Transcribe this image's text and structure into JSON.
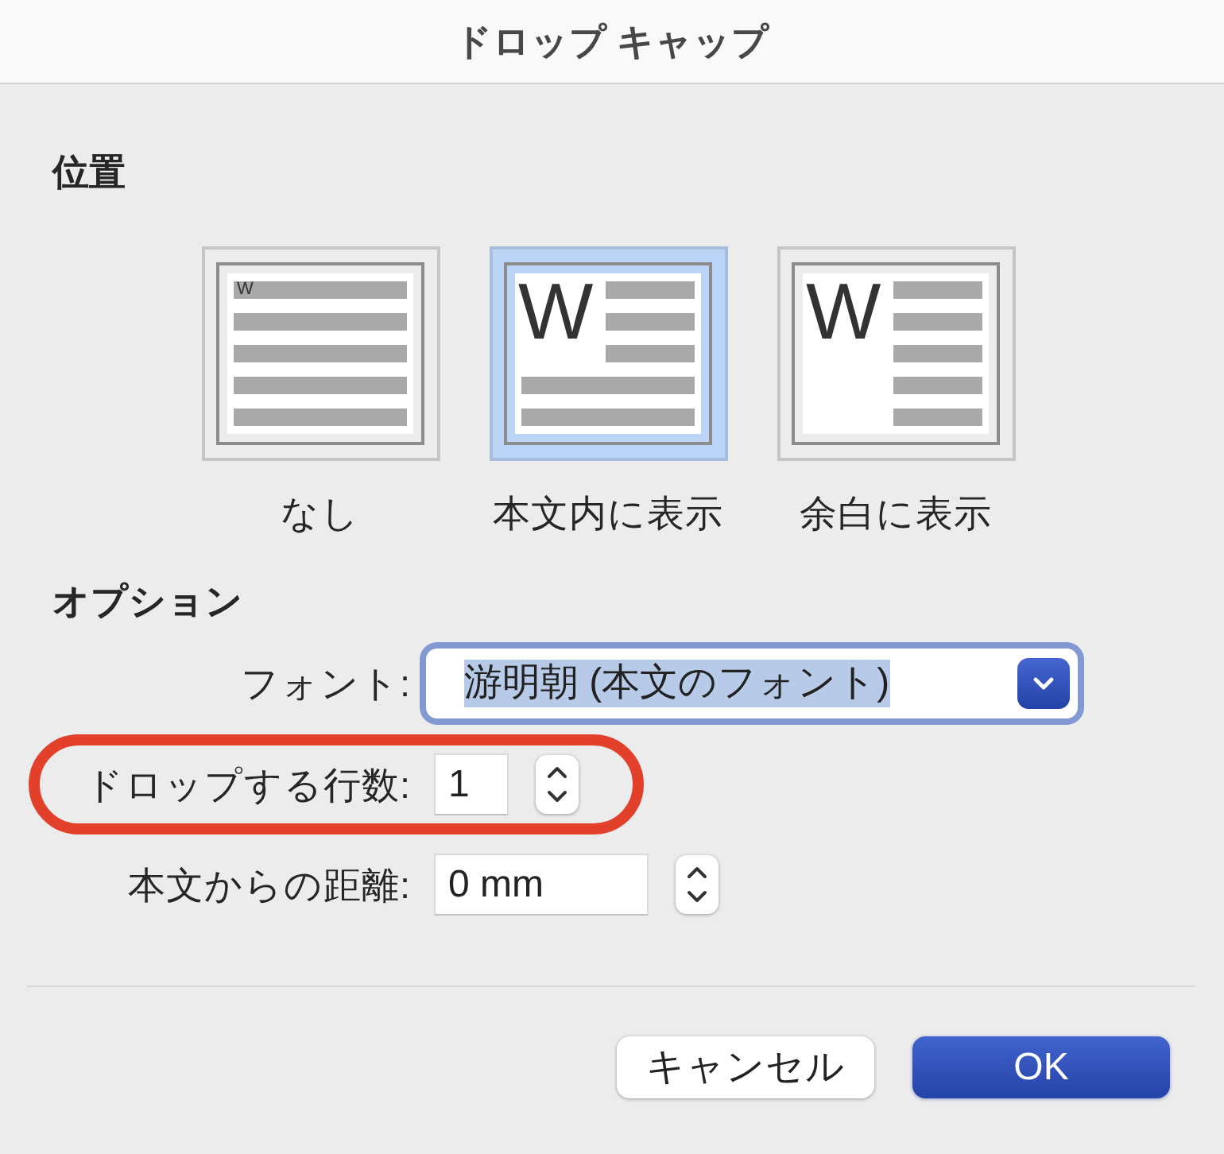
{
  "dialog": {
    "title": "ドロップ キャップ"
  },
  "position": {
    "heading": "位置",
    "options": [
      {
        "kind": "none",
        "letter": "W",
        "label": "なし",
        "selected": false
      },
      {
        "kind": "dropped",
        "letter": "W",
        "label": "本文内に表示",
        "selected": true
      },
      {
        "kind": "margin",
        "letter": "W",
        "label": "余白に表示",
        "selected": false
      }
    ]
  },
  "options": {
    "heading": "オプション",
    "font": {
      "label": "フォント:",
      "value": "游明朝 (本文のフォント)",
      "focused": true
    },
    "fields": [
      {
        "kind": "lines",
        "label": "ドロップする行数:",
        "value": "1",
        "highlighted": true
      },
      {
        "kind": "distance",
        "label": "本文からの距離:",
        "value": "0 mm",
        "highlighted": false
      }
    ]
  },
  "buttons": [
    {
      "kind": "secondary",
      "label": "キャンセル"
    },
    {
      "kind": "default",
      "label": "OK"
    }
  ]
}
